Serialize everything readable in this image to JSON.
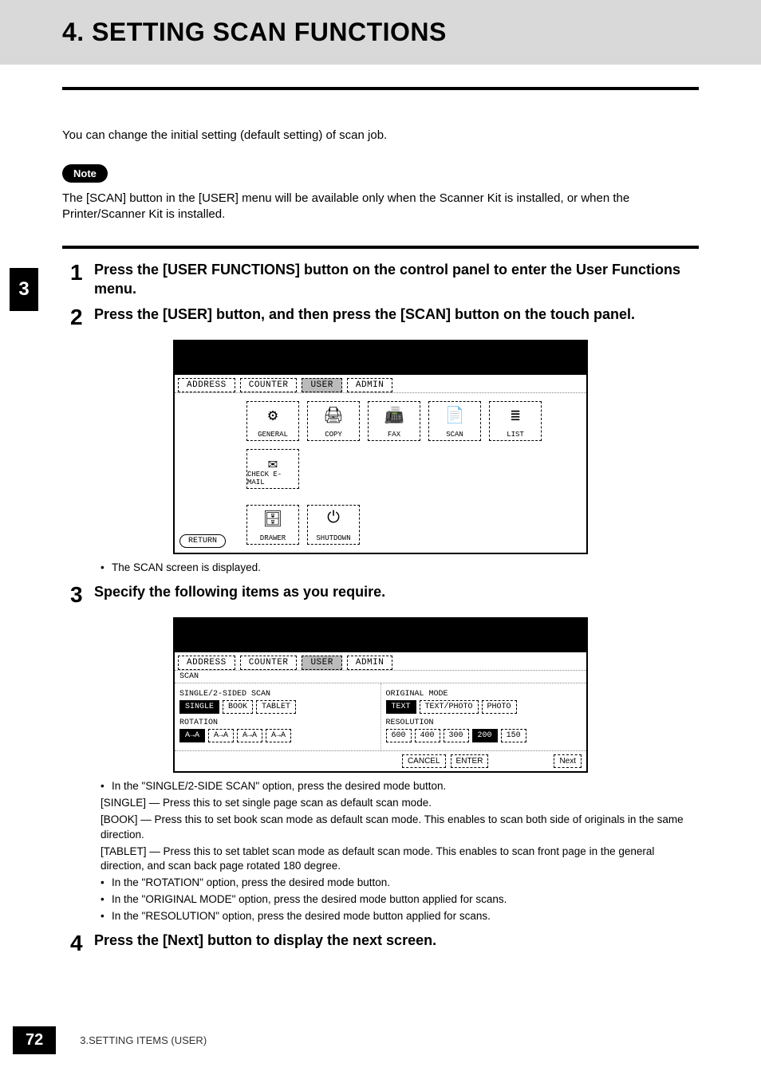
{
  "header": {
    "title": "4. SETTING SCAN FUNCTIONS"
  },
  "intro": "You can change the initial setting (default setting) of scan job.",
  "note": {
    "badge": "Note",
    "text": "The [SCAN] button in the [USER] menu will be available only when the Scanner Kit is installed, or when the Printer/Scanner Kit is installed."
  },
  "side_tab": "3",
  "steps": {
    "s1": {
      "num": "1",
      "title": "Press the [USER FUNCTIONS] button on the control panel to enter the User Functions menu."
    },
    "s2": {
      "num": "2",
      "title": "Press the [USER] button, and then press the [SCAN] button on the touch panel."
    },
    "s3": {
      "num": "3",
      "title": "Specify the following items as you require."
    },
    "s4": {
      "num": "4",
      "title": "Press the [Next] button to display the next screen."
    }
  },
  "panel1": {
    "tabs": [
      "ADDRESS",
      "COUNTER",
      "USER",
      "ADMIN"
    ],
    "active_tab": "USER",
    "buttons_row1": [
      "GENERAL",
      "COPY",
      "FAX",
      "SCAN",
      "LIST",
      "CHECK E-MAIL"
    ],
    "buttons_row2": [
      "DRAWER",
      "SHUTDOWN"
    ],
    "return": "RETURN"
  },
  "panel1_caption": "The SCAN screen is displayed.",
  "panel2": {
    "tabs": [
      "ADDRESS",
      "COUNTER",
      "USER",
      "ADMIN"
    ],
    "active_tab": "USER",
    "scan_label": "SCAN",
    "left": {
      "section1": {
        "label": "SINGLE/2-SIDED SCAN",
        "options": [
          "SINGLE",
          "BOOK",
          "TABLET"
        ],
        "selected": "SINGLE"
      },
      "section2": {
        "label": "ROTATION",
        "options": [
          "A→A",
          "A→A",
          "A→A",
          "A→A"
        ],
        "selected_index": 0
      }
    },
    "right": {
      "section1": {
        "label": "ORIGINAL MODE",
        "options": [
          "TEXT",
          "TEXT/PHOTO",
          "PHOTO"
        ],
        "selected": "TEXT"
      },
      "section2": {
        "label": "RESOLUTION",
        "options": [
          "600",
          "400",
          "300",
          "200",
          "150"
        ],
        "selected": "200"
      }
    },
    "bottom": {
      "cancel": "CANCEL",
      "enter": "ENTER",
      "next": "Next"
    }
  },
  "explain": {
    "l1": "In the \"SINGLE/2-SIDE SCAN\" option, press the desired mode button.",
    "single": "[SINGLE] — Press this to set single page scan as default scan mode.",
    "book": "[BOOK] — Press this to set book scan mode as default scan mode. This enables to scan both side of originals in the same direction.",
    "tablet": "[TABLET] — Press this to set tablet scan mode as default scan mode. This enables to scan front page in the general direction, and scan back page rotated 180 degree.",
    "l2": "In the \"ROTATION\" option, press the desired mode button.",
    "l3": "In the \"ORIGINAL MODE\" option, press the desired mode button applied for scans.",
    "l4": "In the \"RESOLUTION\" option, press the desired mode button applied for scans."
  },
  "footer": {
    "page": "72",
    "text": "3.SETTING ITEMS (USER)"
  }
}
